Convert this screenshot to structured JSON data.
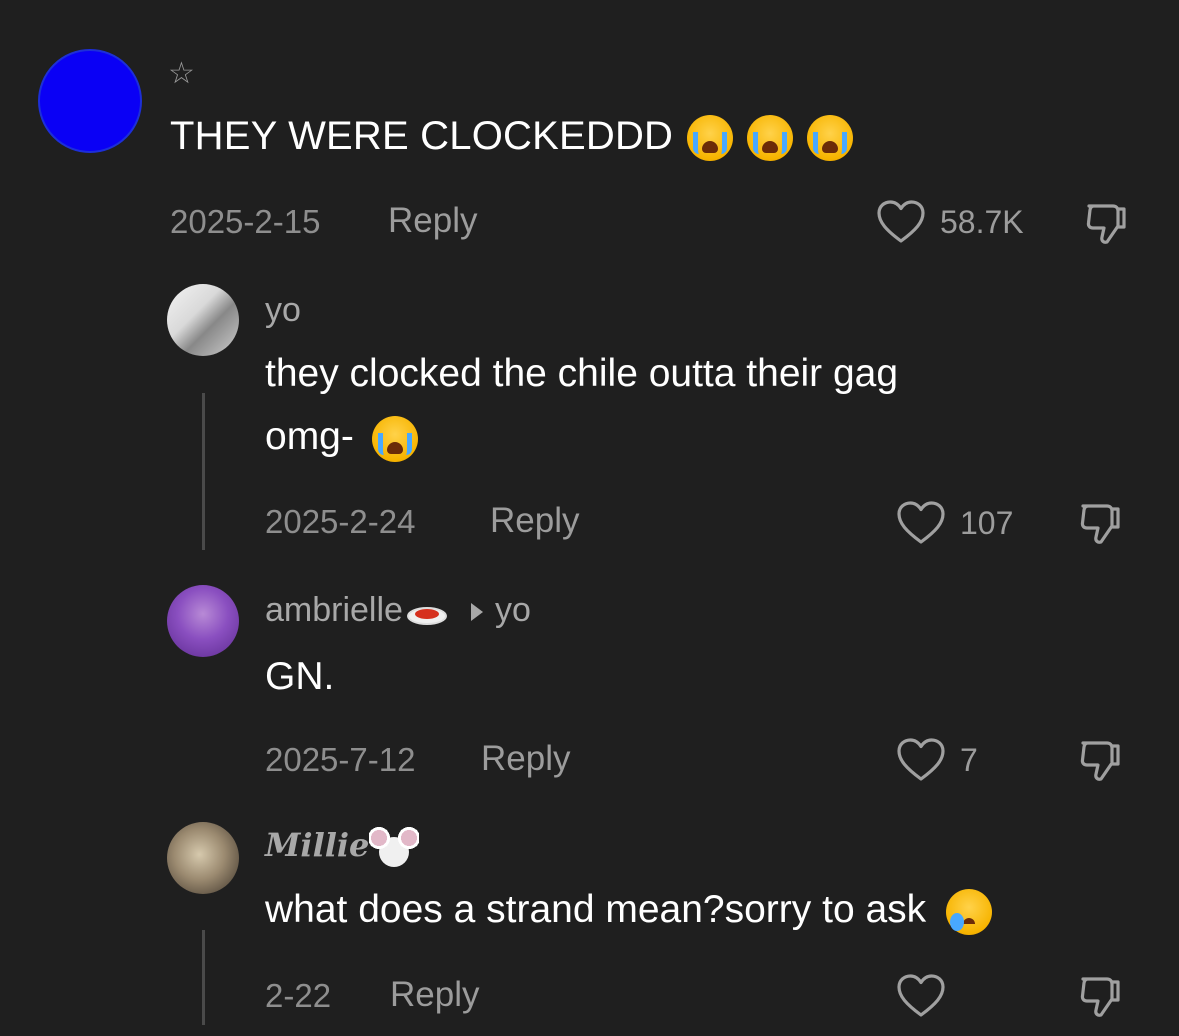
{
  "main_comment": {
    "text": "THEY WERE CLOCKEDDD",
    "emoji_icons": [
      "loudly-crying-face-icon",
      "loudly-crying-face-icon",
      "loudly-crying-face-icon"
    ],
    "date": "2025-2-15",
    "reply_label": "Reply",
    "likes": "58.7K",
    "avatar_color": "#0a00f5"
  },
  "replies": [
    {
      "username": "yo",
      "text_line1": "they clocked the chile outta their gag",
      "text_line2": "omg-",
      "emoji_icon": "loudly-crying-face-icon",
      "date": "2025-2-24",
      "reply_label": "Reply",
      "likes": "107"
    },
    {
      "username": "ambrielle",
      "username_emoji": "spaghetti-icon",
      "reply_to": "yo",
      "text": "GN.",
      "date": "2025-7-12",
      "reply_label": "Reply",
      "likes": "7"
    },
    {
      "username": "Millie",
      "username_emoji": "mouse-face-icon",
      "text": "what does a strand mean?sorry to ask",
      "emoji_icon": "crying-face-icon",
      "date": "2-22",
      "reply_label": "Reply",
      "likes": ""
    }
  ],
  "colors": {
    "background": "#1f1f1f",
    "text_primary": "#ffffff",
    "text_secondary": "#8e8e8e"
  }
}
